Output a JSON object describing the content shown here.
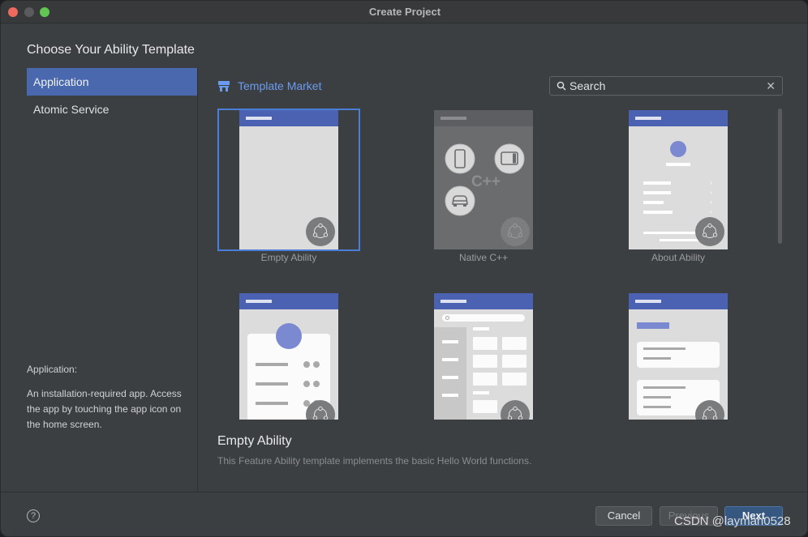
{
  "window": {
    "title": "Create Project"
  },
  "heading": "Choose Your Ability Template",
  "sidebar": {
    "items": [
      {
        "label": "Application",
        "active": true
      },
      {
        "label": "Atomic Service",
        "active": false
      }
    ]
  },
  "description": {
    "title": "Application:",
    "text": "An installation-required app. Access the app by touching the app icon on the home screen."
  },
  "market": {
    "label": "Template Market",
    "icon": "store-icon"
  },
  "search": {
    "value": "",
    "placeholder": "Search",
    "clear_icon": "close-icon"
  },
  "templates": [
    {
      "label": "Empty Ability",
      "selected": true
    },
    {
      "label": "Native C++",
      "selected": false
    },
    {
      "label": "About Ability",
      "selected": false
    },
    {
      "label": "",
      "selected": false
    },
    {
      "label": "",
      "selected": false
    },
    {
      "label": "",
      "selected": false
    }
  ],
  "native_cpp_glyph": "C++",
  "selected_template": {
    "title": "Empty Ability",
    "description": "This Feature Ability template implements the basic Hello World functions."
  },
  "footer": {
    "help_label": "?",
    "cancel_label": "Cancel",
    "previous_label": "Previous",
    "next_label": "Next"
  },
  "watermark": "CSDN @layman0528",
  "colors": {
    "accent": "#4a68ad",
    "link": "#6b9bf0",
    "card_header": "#4b62b3",
    "next_button": "#365880"
  }
}
